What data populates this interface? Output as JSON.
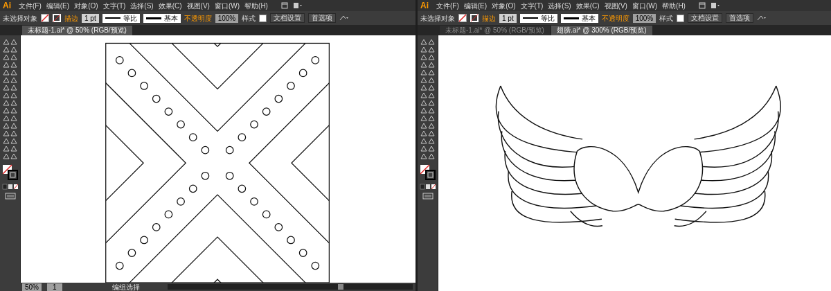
{
  "panels": [
    {
      "logo": "Ai",
      "menu": [
        "文件(F)",
        "编辑(E)",
        "对象(O)",
        "文字(T)",
        "选择(S)",
        "效果(C)",
        "视图(V)",
        "窗口(W)",
        "帮助(H)"
      ],
      "control_bar": {
        "selection": "未选择对象",
        "stroke_label": "描边",
        "stroke_weight": "1 pt",
        "profile": "等比",
        "brush": "基本",
        "opacity_label": "不透明度",
        "opacity": "100%",
        "style_label": "样式",
        "buttons": [
          "文档设置",
          "首选项"
        ]
      },
      "tabs": [
        {
          "label": "未标题-1.ai* @ 50% (RGB/预览)",
          "selected": true
        }
      ],
      "artwork": {
        "kind": "pattern"
      },
      "status_bar": {
        "zoom": "50%",
        "artboard": "1",
        "tool": "编组选择"
      }
    },
    {
      "logo": "Ai",
      "menu": [
        "文件(F)",
        "编辑(E)",
        "对象(O)",
        "文字(T)",
        "选择(S)",
        "效果(C)",
        "视图(V)",
        "窗口(W)",
        "帮助(H)"
      ],
      "control_bar": {
        "selection": "未选择对象",
        "stroke_label": "描边",
        "stroke_weight": "1 pt",
        "profile": "等比",
        "brush": "基本",
        "opacity_label": "不透明度",
        "opacity": "100%",
        "style_label": "样式",
        "buttons": [
          "文档设置",
          "首选项"
        ]
      },
      "tabs": [
        {
          "label": "未标题-1.ai* @ 50% (RGB/预览)",
          "selected": false
        },
        {
          "label": "翅膀.ai* @ 300% (RGB/预览)",
          "selected": true
        }
      ],
      "artwork": {
        "kind": "wings"
      }
    }
  ]
}
